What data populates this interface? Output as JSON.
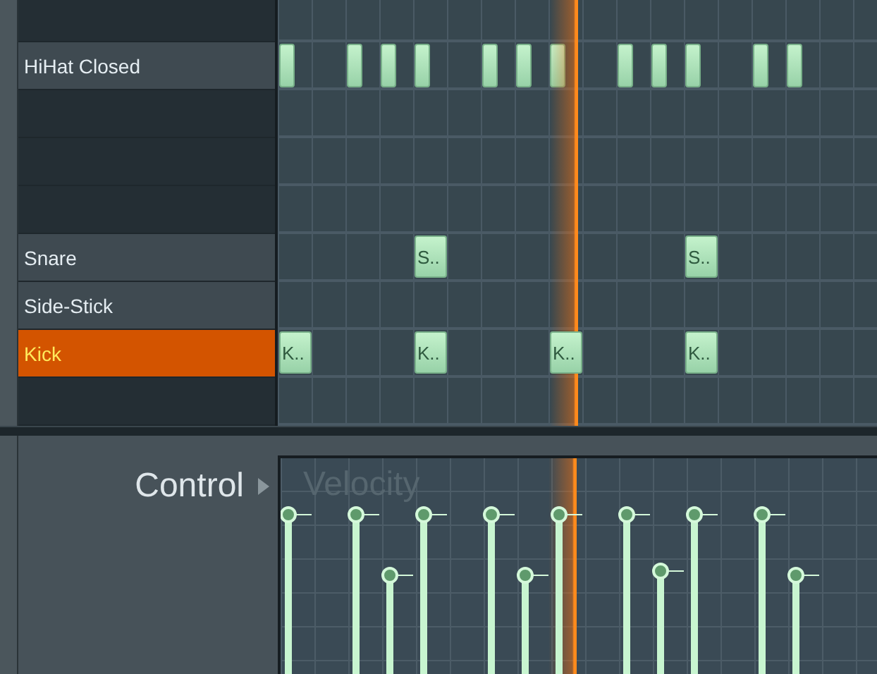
{
  "rows": [
    {
      "kind": "empty",
      "selected": false
    },
    {
      "kind": "drum",
      "label": "HiHat Closed",
      "selected": false,
      "steps": [
        {
          "on": true
        },
        {
          "on": false
        },
        {
          "on": true
        },
        {
          "on": true
        },
        {
          "on": true
        },
        {
          "on": false
        },
        {
          "on": true
        },
        {
          "on": true
        },
        {
          "on": true
        },
        {
          "on": false
        },
        {
          "on": true
        },
        {
          "on": true
        },
        {
          "on": true
        },
        {
          "on": false
        },
        {
          "on": true
        },
        {
          "on": true
        }
      ]
    },
    {
      "kind": "empty",
      "selected": false
    },
    {
      "kind": "empty",
      "selected": false
    },
    {
      "kind": "empty",
      "selected": false
    },
    {
      "kind": "drum",
      "label": "Snare",
      "selected": false,
      "steps": [
        {
          "on": false
        },
        {
          "on": false
        },
        {
          "on": false
        },
        {
          "on": false
        },
        {
          "on": true,
          "label": "S.."
        },
        {
          "on": false
        },
        {
          "on": false
        },
        {
          "on": false
        },
        {
          "on": false
        },
        {
          "on": false
        },
        {
          "on": false
        },
        {
          "on": false
        },
        {
          "on": true,
          "label": "S.."
        },
        {
          "on": false
        },
        {
          "on": false
        },
        {
          "on": false
        }
      ]
    },
    {
      "kind": "drum",
      "label": "Side-Stick",
      "selected": false
    },
    {
      "kind": "drum",
      "label": "Kick",
      "selected": true,
      "steps": [
        {
          "on": true,
          "label": "K.."
        },
        {
          "on": false
        },
        {
          "on": false
        },
        {
          "on": false
        },
        {
          "on": true,
          "label": "K.."
        },
        {
          "on": false
        },
        {
          "on": false
        },
        {
          "on": false
        },
        {
          "on": true,
          "label": "K.."
        },
        {
          "on": false
        },
        {
          "on": false
        },
        {
          "on": false
        },
        {
          "on": true,
          "label": "K.."
        },
        {
          "on": false
        },
        {
          "on": false
        },
        {
          "on": false
        }
      ]
    },
    {
      "kind": "empty",
      "selected": false
    }
  ],
  "control": {
    "label": "Control",
    "parameter": "Velocity"
  }
}
